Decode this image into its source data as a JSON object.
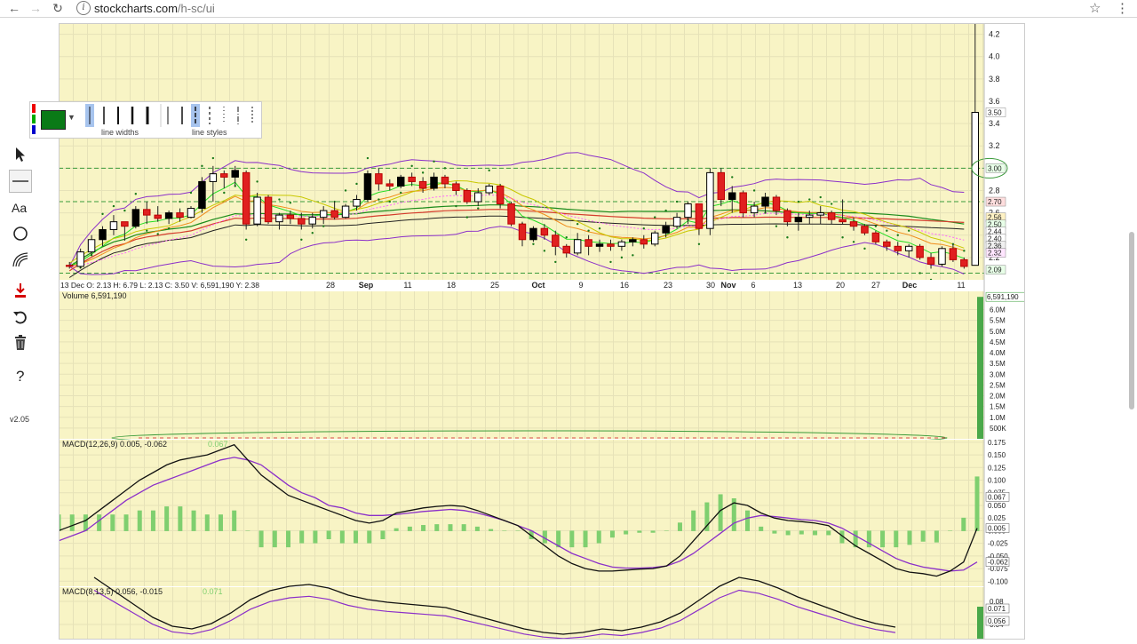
{
  "browser": {
    "url_host": "stockcharts.com",
    "url_path": "/h-sc/ui"
  },
  "toolbar": {
    "version": "v2.05",
    "tools": [
      "pointer-tool",
      "line-tool",
      "text-tool",
      "circle-tool",
      "fibonacci-tool",
      "save-tool",
      "undo-tool",
      "delete-tool",
      "help-tool"
    ]
  },
  "palette": {
    "line_widths_label": "line widths",
    "line_styles_label": "line styles",
    "selected_color": "#0a7a17"
  },
  "chart_data": [
    {
      "panel": "price",
      "type": "candlestick",
      "info_line": "13 Dec O: 2.13   H: 6.79   L: 2.13   C: 3.50   V: 6,591,190   Y: 2.38",
      "x_tick_labels": [
        "28",
        "Sep",
        "11",
        "18",
        "25",
        "Oct",
        "9",
        "16",
        "23",
        "30",
        "Nov",
        "6",
        "13",
        "20",
        "27",
        "Dec",
        "11"
      ],
      "y_ticks": [
        2.2,
        2.4,
        2.6,
        2.8,
        3.0,
        3.2,
        3.4,
        3.6,
        3.8,
        4.0,
        4.2
      ],
      "ylim": [
        2.0,
        4.3
      ],
      "price_labels": [
        "3.50",
        "3.00",
        "2.70",
        "2.56",
        "2.50",
        "2.44",
        "2.40",
        "2.36",
        "2.32",
        "2.09"
      ],
      "candles": [
        [
          2.13,
          2.16,
          2.1,
          2.12
        ],
        [
          2.12,
          2.28,
          2.1,
          2.25
        ],
        [
          2.25,
          2.4,
          2.22,
          2.36
        ],
        [
          2.36,
          2.48,
          2.3,
          2.45
        ],
        [
          2.45,
          2.58,
          2.4,
          2.52
        ],
        [
          2.52,
          2.5,
          2.35,
          2.48
        ],
        [
          2.48,
          2.66,
          2.46,
          2.63
        ],
        [
          2.63,
          2.7,
          2.5,
          2.58
        ],
        [
          2.58,
          2.66,
          2.52,
          2.55
        ],
        [
          2.55,
          2.62,
          2.5,
          2.6
        ],
        [
          2.6,
          2.64,
          2.52,
          2.56
        ],
        [
          2.56,
          2.66,
          2.55,
          2.64
        ],
        [
          2.64,
          2.92,
          2.6,
          2.88
        ],
        [
          2.88,
          3.02,
          2.7,
          2.95
        ],
        [
          2.95,
          2.98,
          2.82,
          2.92
        ],
        [
          2.92,
          3.02,
          2.84,
          2.98
        ],
        [
          2.96,
          2.98,
          2.45,
          2.5
        ],
        [
          2.5,
          2.78,
          2.48,
          2.74
        ],
        [
          2.74,
          2.76,
          2.5,
          2.52
        ],
        [
          2.52,
          2.6,
          2.45,
          2.58
        ],
        [
          2.58,
          2.62,
          2.5,
          2.55
        ],
        [
          2.55,
          2.6,
          2.45,
          2.5
        ],
        [
          2.5,
          2.6,
          2.46,
          2.56
        ],
        [
          2.56,
          2.66,
          2.5,
          2.62
        ],
        [
          2.62,
          2.7,
          2.54,
          2.56
        ],
        [
          2.56,
          2.68,
          2.55,
          2.66
        ],
        [
          2.66,
          2.76,
          2.62,
          2.72
        ],
        [
          2.72,
          2.98,
          2.7,
          2.95
        ],
        [
          2.95,
          3.0,
          2.8,
          2.86
        ],
        [
          2.86,
          2.9,
          2.8,
          2.84
        ],
        [
          2.84,
          2.94,
          2.82,
          2.92
        ],
        [
          2.92,
          2.96,
          2.84,
          2.88
        ],
        [
          2.88,
          2.92,
          2.78,
          2.82
        ],
        [
          2.82,
          2.96,
          2.8,
          2.92
        ],
        [
          2.92,
          2.94,
          2.82,
          2.86
        ],
        [
          2.86,
          2.88,
          2.76,
          2.8
        ],
        [
          2.8,
          2.82,
          2.68,
          2.7
        ],
        [
          2.7,
          2.82,
          2.66,
          2.78
        ],
        [
          2.78,
          2.86,
          2.76,
          2.84
        ],
        [
          2.84,
          2.86,
          2.64,
          2.68
        ],
        [
          2.68,
          2.7,
          2.48,
          2.5
        ],
        [
          2.5,
          2.52,
          2.3,
          2.36
        ],
        [
          2.36,
          2.48,
          2.34,
          2.46
        ],
        [
          2.46,
          2.5,
          2.36,
          2.4
        ],
        [
          2.4,
          2.44,
          2.22,
          2.3
        ],
        [
          2.3,
          2.32,
          2.2,
          2.24
        ],
        [
          2.24,
          2.42,
          2.22,
          2.36
        ],
        [
          2.36,
          2.4,
          2.22,
          2.3
        ],
        [
          2.3,
          2.36,
          2.25,
          2.32
        ],
        [
          2.32,
          2.36,
          2.26,
          2.3
        ],
        [
          2.3,
          2.36,
          2.26,
          2.34
        ],
        [
          2.34,
          2.38,
          2.3,
          2.36
        ],
        [
          2.36,
          2.4,
          2.28,
          2.32
        ],
        [
          2.32,
          2.44,
          2.3,
          2.42
        ],
        [
          2.42,
          2.52,
          2.38,
          2.48
        ],
        [
          2.48,
          2.6,
          2.46,
          2.56
        ],
        [
          2.56,
          2.7,
          2.5,
          2.68
        ],
        [
          2.68,
          2.66,
          2.4,
          2.46
        ],
        [
          2.46,
          3.0,
          2.4,
          2.96
        ],
        [
          2.96,
          3.0,
          2.66,
          2.72
        ],
        [
          2.72,
          2.84,
          2.6,
          2.78
        ],
        [
          2.78,
          2.8,
          2.56,
          2.6
        ],
        [
          2.6,
          2.7,
          2.56,
          2.66
        ],
        [
          2.66,
          2.78,
          2.6,
          2.74
        ],
        [
          2.74,
          2.76,
          2.58,
          2.62
        ],
        [
          2.62,
          2.64,
          2.48,
          2.52
        ],
        [
          2.52,
          2.6,
          2.44,
          2.56
        ],
        [
          2.56,
          2.62,
          2.5,
          2.58
        ],
        [
          2.58,
          2.66,
          2.5,
          2.6
        ],
        [
          2.6,
          2.62,
          2.5,
          2.54
        ],
        [
          2.54,
          2.72,
          2.5,
          2.52
        ],
        [
          2.52,
          2.56,
          2.44,
          2.48
        ],
        [
          2.48,
          2.5,
          2.4,
          2.42
        ],
        [
          2.42,
          2.44,
          2.32,
          2.34
        ],
        [
          2.34,
          2.36,
          2.26,
          2.3
        ],
        [
          2.3,
          2.34,
          2.22,
          2.26
        ],
        [
          2.26,
          2.32,
          2.2,
          2.3
        ],
        [
          2.3,
          2.32,
          2.18,
          2.2
        ],
        [
          2.2,
          2.24,
          2.1,
          2.14
        ],
        [
          2.14,
          2.3,
          2.12,
          2.28
        ],
        [
          2.28,
          2.32,
          2.16,
          2.18
        ],
        [
          2.18,
          2.2,
          2.1,
          2.12
        ],
        [
          2.13,
          6.79,
          2.13,
          3.5
        ]
      ]
    },
    {
      "panel": "volume",
      "type": "bar",
      "label": "Volume 6,591,190",
      "y_tick_labels": [
        "500K",
        "1.0M",
        "1.5M",
        "2.0M",
        "2.5M",
        "3.0M",
        "3.5M",
        "4.0M",
        "4.5M",
        "5.0M",
        "5.5M",
        "6.0M"
      ],
      "last_value_label": "6,591,190",
      "last_value": 6591190
    },
    {
      "panel": "macd1",
      "type": "line",
      "label": "MACD(12,26,9) 0.005, -0.062",
      "label_extra": "0.067",
      "y_ticks": [
        -0.1,
        -0.075,
        -0.05,
        -0.025,
        0.0,
        0.025,
        0.05,
        0.075,
        0.1,
        0.125,
        0.15,
        0.175
      ],
      "ylim": [
        -0.11,
        0.18
      ],
      "value_labels": [
        "0.067",
        "0.005",
        "-0.062"
      ],
      "macd": [
        0.0,
        0.01,
        0.02,
        0.04,
        0.06,
        0.08,
        0.1,
        0.115,
        0.13,
        0.14,
        0.145,
        0.15,
        0.16,
        0.17,
        0.14,
        0.11,
        0.09,
        0.07,
        0.06,
        0.05,
        0.04,
        0.03,
        0.02,
        0.015,
        0.02,
        0.035,
        0.04,
        0.045,
        0.048,
        0.05,
        0.048,
        0.04,
        0.03,
        0.02,
        0.01,
        -0.01,
        -0.03,
        -0.05,
        -0.065,
        -0.075,
        -0.08,
        -0.08,
        -0.078,
        -0.076,
        -0.075,
        -0.07,
        -0.05,
        -0.02,
        0.01,
        0.04,
        0.055,
        0.05,
        0.035,
        0.025,
        0.02,
        0.018,
        0.015,
        0.01,
        -0.01,
        -0.03,
        -0.045,
        -0.06,
        -0.075,
        -0.082,
        -0.085,
        -0.09,
        -0.08,
        -0.062,
        0.005
      ],
      "signal": [
        -0.02,
        -0.01,
        0.0,
        0.02,
        0.04,
        0.06,
        0.075,
        0.09,
        0.1,
        0.11,
        0.12,
        0.13,
        0.14,
        0.145,
        0.14,
        0.13,
        0.11,
        0.09,
        0.075,
        0.065,
        0.05,
        0.045,
        0.035,
        0.03,
        0.03,
        0.032,
        0.035,
        0.038,
        0.04,
        0.042,
        0.04,
        0.035,
        0.028,
        0.02,
        0.01,
        0.0,
        -0.015,
        -0.03,
        -0.045,
        -0.055,
        -0.065,
        -0.072,
        -0.074,
        -0.074,
        -0.073,
        -0.07,
        -0.06,
        -0.045,
        -0.025,
        -0.005,
        0.015,
        0.025,
        0.03,
        0.028,
        0.025,
        0.022,
        0.02,
        0.015,
        0.005,
        -0.01,
        -0.025,
        -0.04,
        -0.055,
        -0.065,
        -0.072,
        -0.076,
        -0.08,
        -0.078,
        -0.062
      ]
    },
    {
      "panel": "macd2",
      "type": "line",
      "label": "MACD(8,13,5) 0.056, -0.015",
      "label_extra": "0.071",
      "y_tick_labels": [
        "0.08",
        "0.04"
      ],
      "value_labels": [
        "0.071",
        "0.056"
      ]
    }
  ]
}
